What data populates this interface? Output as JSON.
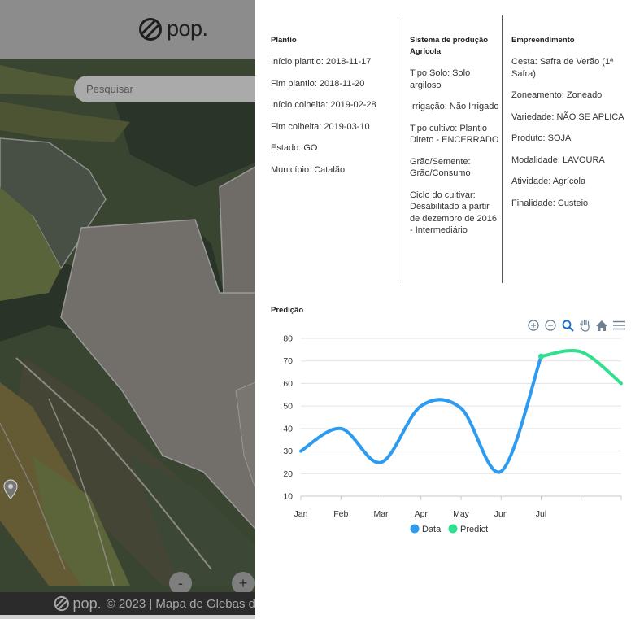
{
  "app": {
    "logo_text": "pop.",
    "search_placeholder": "Pesquisar",
    "zoom_out_label": "-",
    "zoom_in_label": "+",
    "footer": {
      "logo_text": "pop.",
      "text": "© 2023 | Mapa de Glebas d"
    }
  },
  "details": {
    "plantio": {
      "title": "Plantio",
      "items": [
        "Início plantio: 2018-11-17",
        "Fim plantio: 2018-11-20",
        "Início colheita: 2019-02-28",
        "Fim colheita: 2019-03-10",
        "Estado: GO",
        "Município: Catalão"
      ]
    },
    "sistema": {
      "title": "Sistema de produção Agrícola",
      "items": [
        "Tipo Solo: Solo argiloso",
        "Irrigação: Não Irrigado",
        "Tipo cultivo: Plantio Direto - ENCERRADO",
        "Grão/Semente: Grão/Consumo",
        "Ciclo do cultivar: Desabilitado a partir de dezembro de 2016 - Intermediário"
      ]
    },
    "empreendimento": {
      "title": "Empreendimento",
      "items": [
        "Cesta: Safra de Verão (1ª Safra)",
        "Zoneamento: Zoneado",
        "Variedade: NÃO SE APLICA",
        "Produto: SOJA",
        "Modalidade: LAVOURA",
        "Atividade: Agrícola",
        "Finalidade: Custeio"
      ]
    }
  },
  "prediction": {
    "title": "Predição",
    "toolbar_icons": [
      "zoom-in-icon",
      "zoom-out-icon",
      "magnifier-icon",
      "pan-hand-icon",
      "home-icon",
      "menu-icon"
    ]
  },
  "chart_data": {
    "type": "line",
    "categories": [
      "Jan",
      "Feb",
      "Mar",
      "Apr",
      "May",
      "Jun",
      "Jul"
    ],
    "ylim": [
      10,
      80
    ],
    "yticks": [
      10,
      20,
      30,
      40,
      50,
      60,
      70,
      80
    ],
    "grid": true,
    "legend_position": "bottom",
    "series": [
      {
        "name": "Data",
        "color": "#2d9bf0",
        "x": [
          0,
          1,
          2,
          3,
          4,
          5,
          6
        ],
        "values": [
          30,
          40,
          25,
          50,
          49,
          21,
          72
        ]
      },
      {
        "name": "Predict",
        "color": "#2fe08e",
        "x": [
          6,
          7,
          8
        ],
        "values": [
          72,
          74,
          60
        ]
      }
    ]
  }
}
